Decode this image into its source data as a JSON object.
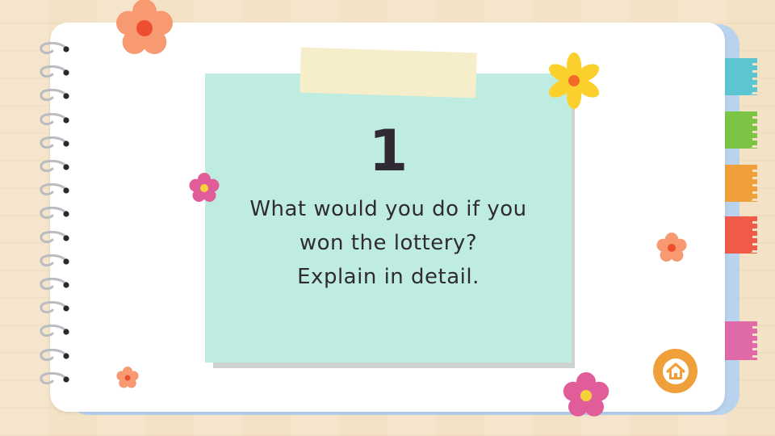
{
  "card": {
    "number": "1",
    "prompt_line1": "What would you do if you",
    "prompt_line2": "won the lottery?",
    "prompt_line3": "Explain in detail."
  },
  "colors": {
    "note": "#bfece0",
    "tape": "#f6eecb",
    "page": "#ffffff",
    "tabs": [
      "#5bc6d2",
      "#7cc444",
      "#f0a03a",
      "#f05a48",
      "#e06aa8"
    ],
    "home_button": "#f0a03a"
  },
  "icons": {
    "home": "home-icon",
    "flowers": [
      "orange-flower",
      "yellow-flower",
      "pink-flower",
      "peach-flower"
    ]
  }
}
